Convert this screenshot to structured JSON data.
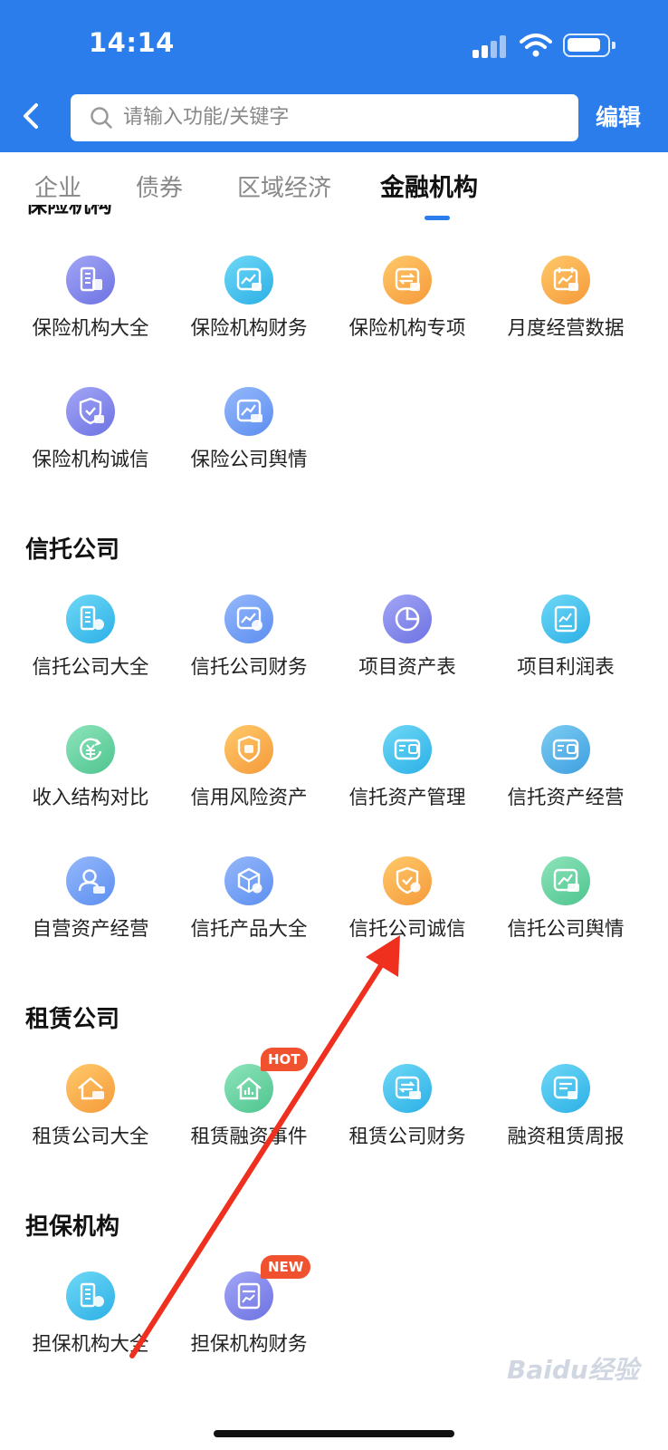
{
  "status_bar": {
    "time": "14:14"
  },
  "search": {
    "placeholder": "请输入功能/关键字",
    "edit_label": "编辑"
  },
  "tabs": [
    {
      "label": "企业",
      "active": false
    },
    {
      "label": "债券",
      "active": false
    },
    {
      "label": "区域经济",
      "active": false
    },
    {
      "label": "金融机构",
      "active": true
    }
  ],
  "sections": {
    "insurance": {
      "title": "保险机构",
      "items": [
        {
          "label": "保险机构大全",
          "icon": "building-insurance-icon",
          "color": "#7c80ea"
        },
        {
          "label": "保险机构财务",
          "icon": "chart-insurance-icon",
          "color": "#38c0ec"
        },
        {
          "label": "保险机构专项",
          "icon": "transfer-insurance-icon",
          "color": "#f7a847"
        },
        {
          "label": "月度经营数据",
          "icon": "calendar-chart-insurance-icon",
          "color": "#f7a847"
        },
        {
          "label": "保险机构诚信",
          "icon": "shield-insurance-icon",
          "color": "#7c80ea"
        },
        {
          "label": "保险公司舆情",
          "icon": "trend-insurance-icon",
          "color": "#6d9af2"
        }
      ]
    },
    "trust": {
      "title": "信托公司",
      "items": [
        {
          "label": "信托公司大全",
          "icon": "building-trust-icon",
          "color": "#38c0ec"
        },
        {
          "label": "信托公司财务",
          "icon": "chart-trust-icon",
          "color": "#6d9af2"
        },
        {
          "label": "项目资产表",
          "icon": "pie-chart-icon",
          "color": "#7c80ea"
        },
        {
          "label": "项目利润表",
          "icon": "report-icon",
          "color": "#38c0ec"
        },
        {
          "label": "收入结构对比",
          "icon": "yuan-cycle-icon",
          "color": "#5bcb98"
        },
        {
          "label": "信用风险资产",
          "icon": "shield-credit-icon",
          "color": "#f7a847"
        },
        {
          "label": "信托资产管理",
          "icon": "wallet-icon",
          "color": "#38c0ec"
        },
        {
          "label": "信托资产经营",
          "icon": "wallet-icon",
          "color": "#4aa6e2"
        },
        {
          "label": "自营资产经营",
          "icon": "person-icon",
          "color": "#6d9af2"
        },
        {
          "label": "信托产品大全",
          "icon": "cube-icon",
          "color": "#6d9af2"
        },
        {
          "label": "信托公司诚信",
          "icon": "shield-trust-icon",
          "color": "#f7a847"
        },
        {
          "label": "信托公司舆情",
          "icon": "trend-trust-icon",
          "color": "#5bcb98"
        }
      ]
    },
    "leasing": {
      "title": "租赁公司",
      "items": [
        {
          "label": "租赁公司大全",
          "icon": "house-lease-icon",
          "color": "#f7a847"
        },
        {
          "label": "租赁融资事件",
          "icon": "house-chart-icon",
          "color": "#5bcb98",
          "badge": "HOT"
        },
        {
          "label": "租赁公司财务",
          "icon": "transfer-lease-icon",
          "color": "#38c0ec"
        },
        {
          "label": "融资租赁周报",
          "icon": "weekly-report-icon",
          "color": "#38c0ec"
        }
      ]
    },
    "guarantee": {
      "title": "担保机构",
      "items": [
        {
          "label": "担保机构大全",
          "icon": "building-guarantee-icon",
          "color": "#38c0ec"
        },
        {
          "label": "担保机构财务",
          "icon": "chart-guarantee-icon",
          "color": "#7c80ea",
          "badge": "NEW"
        }
      ]
    }
  },
  "annotation": {
    "color": "#f0301e"
  },
  "watermark": "Baidu经验"
}
